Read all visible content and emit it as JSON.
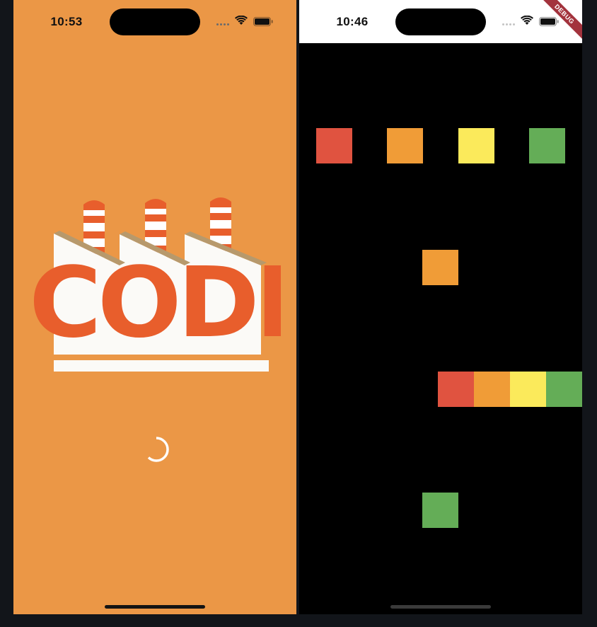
{
  "left_phone": {
    "status_time": "10:53",
    "background_color": "#eb9746",
    "logo_text": "CODE",
    "logo_color": "#e85e2c",
    "spinner_icon": "loading-spinner-icon"
  },
  "right_phone": {
    "status_time": "10:46",
    "background_color": "#000000",
    "debug_banner": "DEBUG",
    "colors": {
      "red": "#e05340",
      "orange": "#f09c37",
      "yellow": "#fbea5b",
      "green": "#64ad57"
    },
    "rows": [
      {
        "row": "top",
        "squares": [
          "red",
          "orange",
          "yellow",
          "green"
        ]
      },
      {
        "row": "second",
        "squares": [
          "orange"
        ]
      },
      {
        "row": "third",
        "squares": [
          "red",
          "orange",
          "yellow",
          "green"
        ]
      },
      {
        "row": "bottom",
        "squares": [
          "green"
        ]
      }
    ]
  },
  "icons": [
    "wifi-icon",
    "battery-icon",
    "cellular-signal-icon"
  ]
}
